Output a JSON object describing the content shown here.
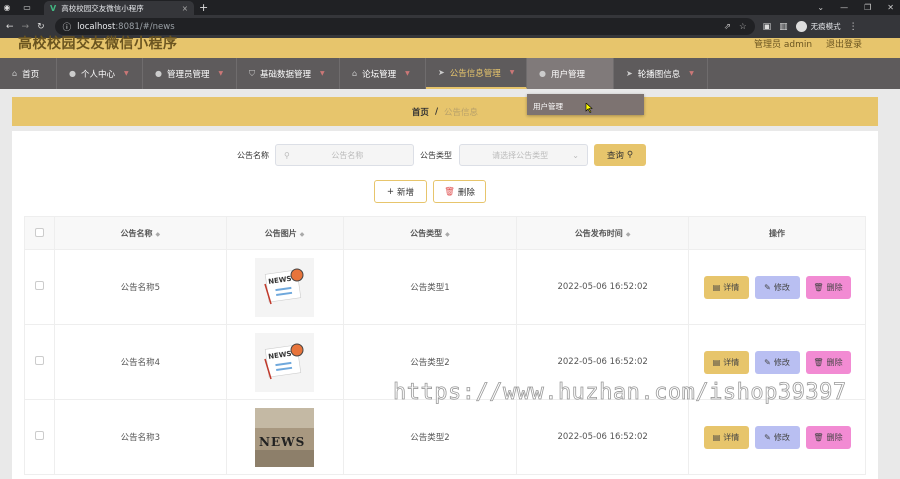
{
  "browser": {
    "tab_title": "高校校园交友微信小程序",
    "tab_close": "×",
    "new_tab": "+",
    "url_host": "localhost",
    "url_path": ":8081/#/news",
    "profile_label": "无痕模式"
  },
  "header": {
    "title": "高校校园交友微信小程序",
    "admin": "管理员 admin",
    "logout": "退出登录"
  },
  "nav": {
    "items": [
      {
        "label": "首页",
        "icon": "home-icon"
      },
      {
        "label": "个人中心",
        "icon": "user-icon"
      },
      {
        "label": "管理员管理",
        "icon": "user-icon"
      },
      {
        "label": "基础数据管理",
        "icon": "shield-icon"
      },
      {
        "label": "论坛管理",
        "icon": "bank-icon"
      },
      {
        "label": "公告信息管理",
        "icon": "send-icon"
      },
      {
        "label": "用户管理",
        "icon": "user-icon"
      },
      {
        "label": "轮播图信息",
        "icon": "send-icon"
      }
    ],
    "dropdown_item": "用户管理"
  },
  "breadcrumb": {
    "home": "首页",
    "sep": "/",
    "current": "公告信息"
  },
  "search": {
    "name_label": "公告名称",
    "name_placeholder": "公告名称",
    "type_label": "公告类型",
    "type_placeholder": "请选择公告类型",
    "query_label": "查询"
  },
  "toolbar": {
    "add_label": "新增",
    "delete_label": "删除"
  },
  "table": {
    "headers": [
      "公告名称",
      "公告图片",
      "公告类型",
      "公告发布时间",
      "操作"
    ],
    "rows": [
      {
        "name": "公告名称5",
        "type": "公告类型1",
        "time": "2022-05-06 16:52:02",
        "image": "news-illustration"
      },
      {
        "name": "公告名称4",
        "type": "公告类型2",
        "time": "2022-05-06 16:52:02",
        "image": "news-illustration"
      },
      {
        "name": "公告名称3",
        "type": "公告类型2",
        "time": "2022-05-06 16:52:02",
        "image": "news-photo"
      }
    ],
    "actions": {
      "detail": "详情",
      "edit": "修改",
      "remove": "删除"
    }
  },
  "watermark": "https://www.huzhan.com/ishop39397",
  "colors": {
    "accent": "#e7c56c",
    "nav_bg": "#5e5b5c",
    "edit": "#b9bff2",
    "remove": "#f28bd3"
  }
}
